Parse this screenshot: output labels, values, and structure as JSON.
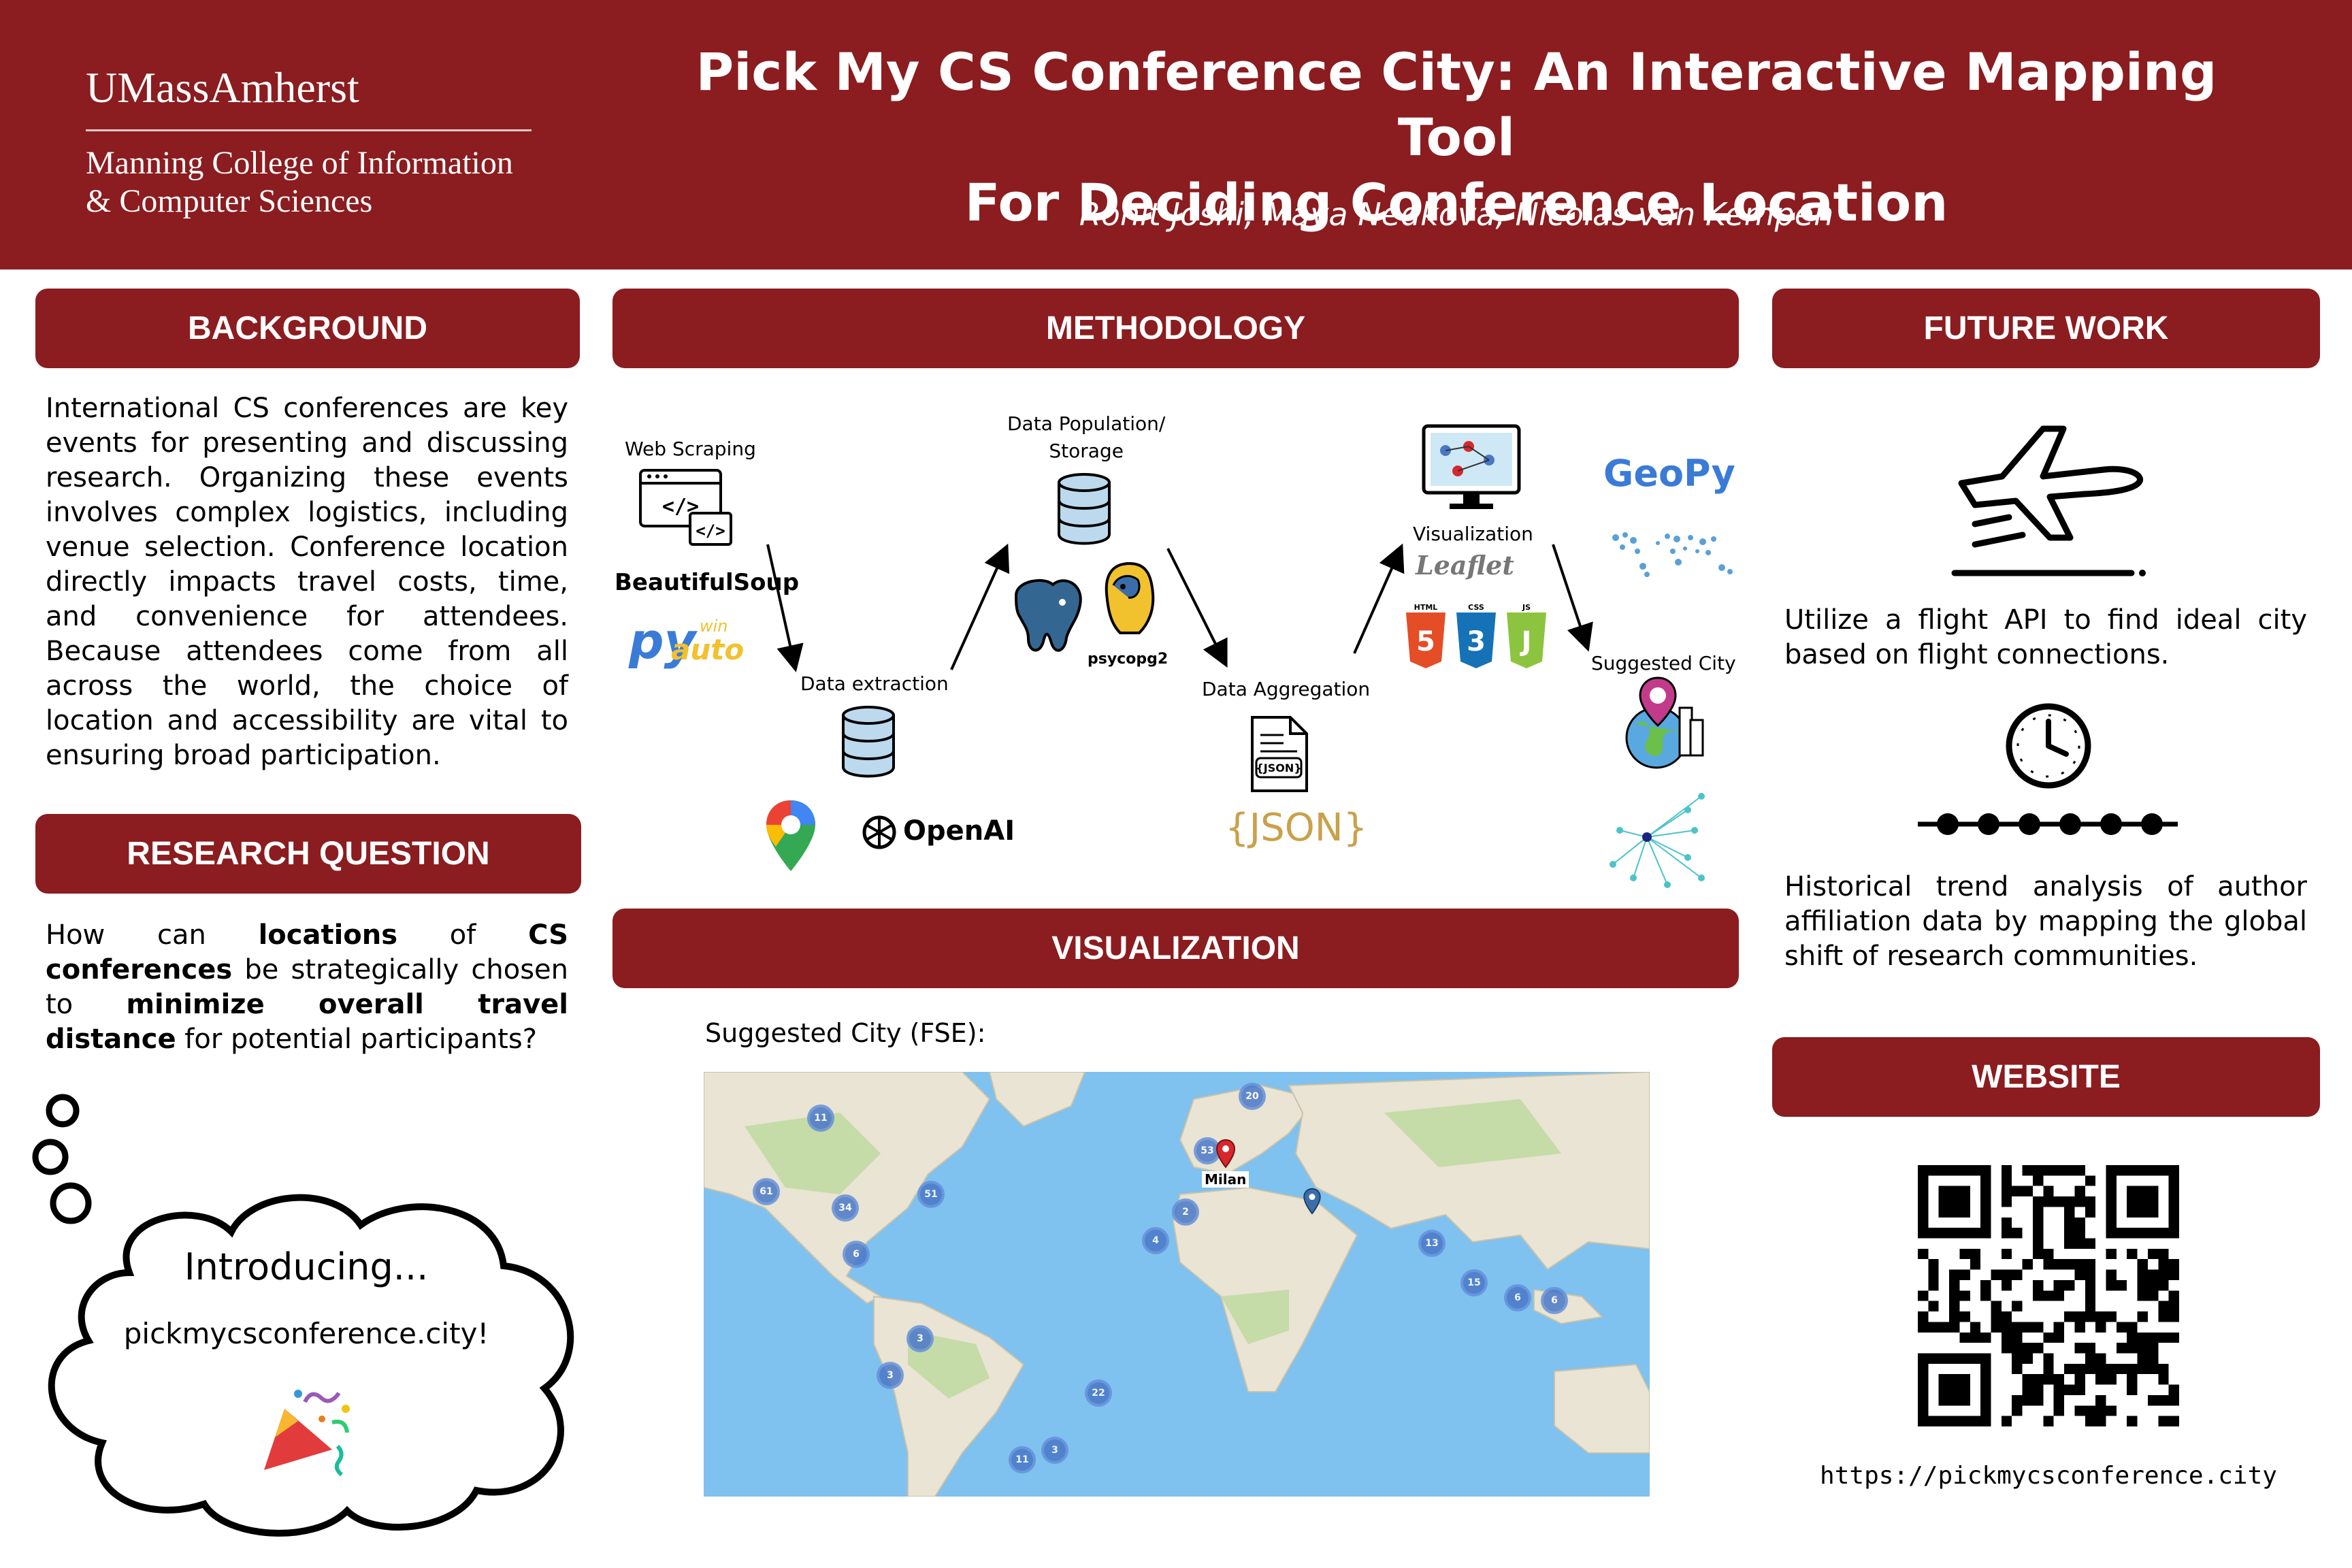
{
  "header": {
    "logo_name": "UMassAmherst",
    "logo_sub": "Manning College of Information\n& Computer Sciences",
    "title": "Pick My CS Conference City: An Interactive Mapping Tool\nFor Deciding Conference Location",
    "authors": "Rohit Joshi, Maya Nedkova, Nicolas van Kempen"
  },
  "sections": {
    "background": "BACKGROUND",
    "methodology": "METHODOLOGY",
    "future_work": "FUTURE WORK",
    "research_question": "RESEARCH QUESTION",
    "visualization": "VISUALIZATION",
    "website": "WEBSITE"
  },
  "background_text": "International CS conferences are key events for presenting and discussing research. Organizing these events involves complex logistics, including venue selection. Conference location directly impacts travel costs, time, and convenience for attendees. Because attendees come from all across the world, the choice of location and accessibility are vital to ensuring broad participation.",
  "research_question": {
    "p1": "How can ",
    "b1": "locations",
    "p2": " of ",
    "b2": "CS conferences",
    "p3": " be strategically chosen to ",
    "b3": "minimize overall travel distance",
    "p4": " for potential participants?"
  },
  "bubble": {
    "line1": "Introducing...",
    "line2": "pickmycsconference.city!"
  },
  "methodology": {
    "web_scraping": "Web Scraping",
    "data_extraction": "Data extraction",
    "data_population": "Data Population/\nStorage",
    "data_aggregation": "Data Aggregation",
    "visualization": "Visualization",
    "suggested_city": "Suggested City",
    "beautifulsoup": "BeautifulSoup",
    "pyautowin_py": "py",
    "pyautowin_win": "win",
    "pyautowin_auto": "auto",
    "openai": "OpenAI",
    "psycopg2": "psycopg2",
    "json": "{JSON}",
    "json_small": "{JSON}",
    "geopy": "GeoPy",
    "leaflet": "Leaflet",
    "html": "HTML",
    "css": "CSS",
    "js": "JS"
  },
  "visualization": {
    "caption": "Suggested City (FSE):",
    "map_city": "Milan",
    "clusters": [
      "11",
      "20",
      "61",
      "34",
      "51",
      "6",
      "53",
      "2",
      "4",
      "13",
      "15",
      "6",
      "3",
      "3",
      "22",
      "11",
      "3",
      "6"
    ]
  },
  "future_work": {
    "item1": "Utilize a flight API to find ideal city based on flight connections.",
    "item2": "Historical trend analysis of author affiliation data by mapping the global shift of research communities."
  },
  "website": {
    "url": "https://pickmycsconference.city"
  },
  "colors": {
    "brand": "#8b1c1f",
    "map_water": "#7fc1ef",
    "map_land": "#e9e4d3",
    "cluster": "#4a78c8",
    "pin": "#d8262d"
  }
}
